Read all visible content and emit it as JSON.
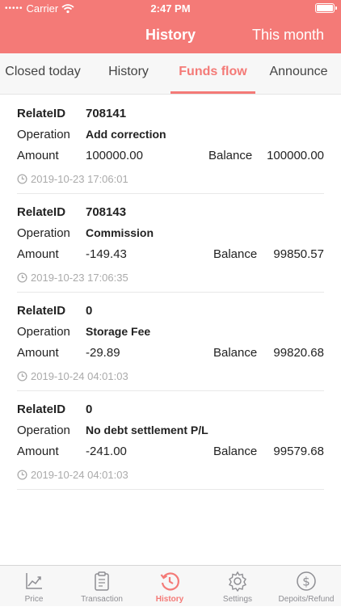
{
  "status_bar": {
    "carrier": "Carrier",
    "time": "2:47 PM"
  },
  "nav": {
    "title": "History",
    "right_action": "This month"
  },
  "tabs": [
    {
      "label": "Closed today"
    },
    {
      "label": "History"
    },
    {
      "label": "Funds flow"
    },
    {
      "label": "Announce"
    }
  ],
  "active_tab": "Funds flow",
  "labels": {
    "relate_id": "RelateID",
    "operation": "Operation",
    "amount": "Amount",
    "balance": "Balance"
  },
  "records": [
    {
      "relate_id": "708141",
      "operation": "Add correction",
      "amount": "100000.00",
      "balance": "100000.00",
      "timestamp": "2019-10-23 17:06:01"
    },
    {
      "relate_id": "708143",
      "operation": "Commission",
      "amount": "-149.43",
      "balance": "99850.57",
      "timestamp": "2019-10-23 17:06:35"
    },
    {
      "relate_id": "0",
      "operation": "Storage Fee",
      "amount": "-29.89",
      "balance": "99820.68",
      "timestamp": "2019-10-24 04:01:03"
    },
    {
      "relate_id": "0",
      "operation": "No debt settlement P/L",
      "amount": "-241.00",
      "balance": "99579.68",
      "timestamp": "2019-10-24 04:01:03"
    }
  ],
  "tab_bar": [
    {
      "label": "Price",
      "icon": "chart-icon"
    },
    {
      "label": "Transaction",
      "icon": "clipboard-icon"
    },
    {
      "label": "History",
      "icon": "history-icon"
    },
    {
      "label": "Settings",
      "icon": "gear-icon"
    },
    {
      "label": "Depoits/Refund",
      "icon": "dollar-icon"
    }
  ],
  "active_tab_bar": "History",
  "colors": {
    "accent": "#f47a77",
    "text": "#222222",
    "muted": "#aaaaaa",
    "tab_inactive": "#8e8e93"
  }
}
